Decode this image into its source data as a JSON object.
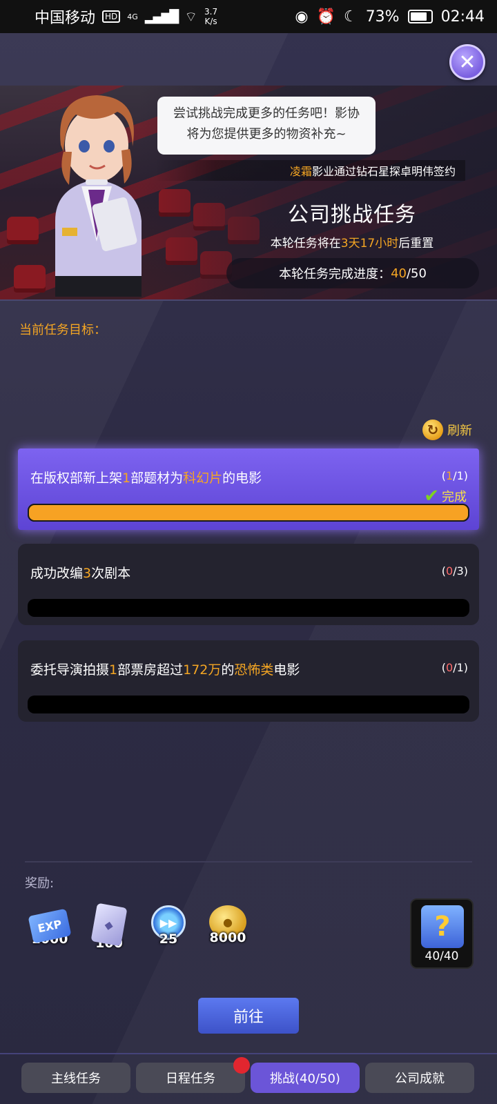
{
  "status_bar": {
    "carrier": "中国移动",
    "hd": "HD",
    "network": "4G",
    "speed_value": "3.7",
    "speed_unit": "K/s",
    "battery": "73%",
    "time": "02:44"
  },
  "banner": {
    "speech": "尝试挑战完成更多的任务吧！影协将为您提供更多的物资补充~",
    "ticker_name": "凌霜",
    "ticker_text": "影业通过钻石星探卓明伟签约",
    "title": "公司挑战任务",
    "reset_prefix": "本轮任务将在",
    "reset_time": "3天17小时",
    "reset_suffix": "后重置",
    "progress_label": "本轮任务完成进度：",
    "progress_current": "40",
    "progress_total": "/50"
  },
  "objective_label": "当前任务目标：",
  "refresh_label": "刷新",
  "tasks": [
    {
      "parts": [
        "在版权部新上架",
        "1",
        "部题材为",
        "科幻片",
        "的电影"
      ],
      "count_open": "(",
      "count_current": "1",
      "count_total": "/1)",
      "done_label": "完成",
      "progress": 1.0
    },
    {
      "parts": [
        "成功改编",
        "3",
        "次剧本"
      ],
      "count_open": "(",
      "count_current": "0",
      "count_total": "/3)",
      "progress": 0.0
    },
    {
      "parts": [
        "委托导演拍摄",
        "1",
        "部票房超过",
        "172万",
        "的",
        "恐怖类",
        "电影"
      ],
      "count_open": "(",
      "count_current": "0",
      "count_total": "/1)",
      "progress": 0.0
    }
  ],
  "rewards": {
    "label": "奖励:",
    "items": [
      {
        "icon": "exp-ticket-icon",
        "icon_text": "EXP",
        "amount": "1000"
      },
      {
        "icon": "card-icon",
        "icon_text": "",
        "amount": "100"
      },
      {
        "icon": "speedup-clock-icon",
        "icon_text": "▶▶",
        "amount": "25"
      },
      {
        "icon": "gold-coins-icon",
        "icon_text": "",
        "amount": "8000"
      }
    ],
    "gift_count": "40/40",
    "gift_symbol": "?"
  },
  "go_button": "前往",
  "tabs": [
    {
      "label": "主线任务"
    },
    {
      "label": "日程任务"
    },
    {
      "label": "挑战(40/50)"
    },
    {
      "label": "公司成就"
    }
  ],
  "colors": {
    "accent": "#f5a623",
    "active_tab": "#6b55d8",
    "active_card": "#6d53e2",
    "progress_fill": "#f7a223"
  }
}
